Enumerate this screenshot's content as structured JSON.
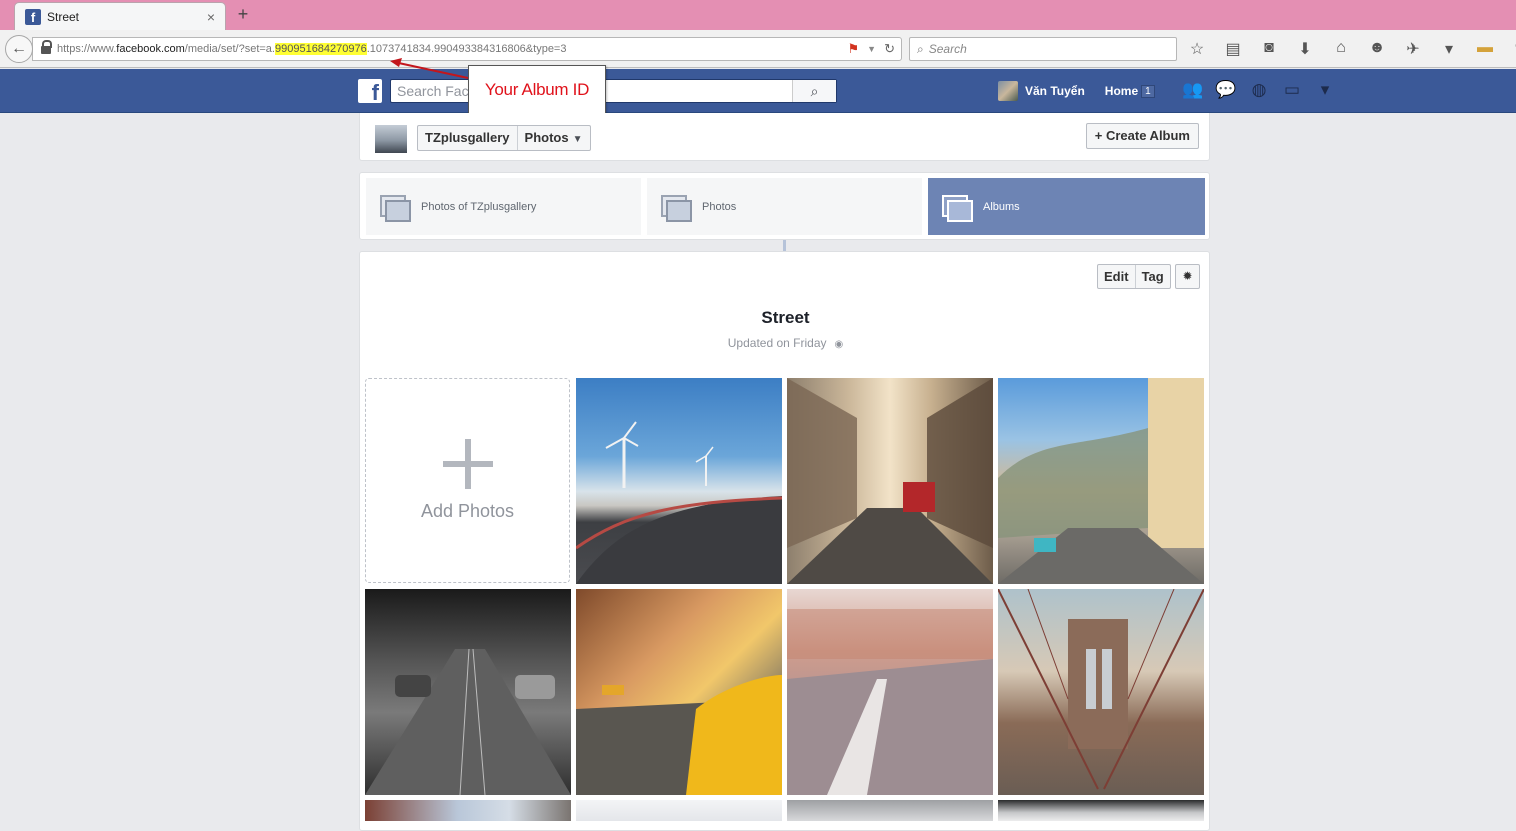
{
  "browser": {
    "tab_title": "Street",
    "tab_close": "×",
    "new_tab": "+",
    "url_prefix": "https://www.",
    "url_host": "facebook.com",
    "url_path": "/media/set/?set=a.",
    "url_highlight": "990951684270976",
    "url_rest": ".1073741834.990493384316806&type=3",
    "search_placeholder": "Search",
    "highlight_color": "#ffff33"
  },
  "facebook": {
    "brand_color": "#3b5998",
    "logo_letter": "f",
    "search_placeholder": "Search Fac",
    "user_name": "Văn Tuyển",
    "home_label": "Home",
    "home_count": "1"
  },
  "annotation": {
    "label": "Your Album ID",
    "color": "#e0121b"
  },
  "album_header": {
    "page_name": "TZplusgallery",
    "section": "Photos",
    "create_album": "+ Create Album"
  },
  "photo_tabs": [
    {
      "label": "Photos of TZplusgallery",
      "active": false
    },
    {
      "label": "Photos",
      "active": false
    },
    {
      "label": "Albums",
      "active": true
    }
  ],
  "album": {
    "edit": "Edit",
    "tag": "Tag",
    "title": "Street",
    "updated": "Updated on Friday",
    "add_photos": "Add Photos"
  }
}
